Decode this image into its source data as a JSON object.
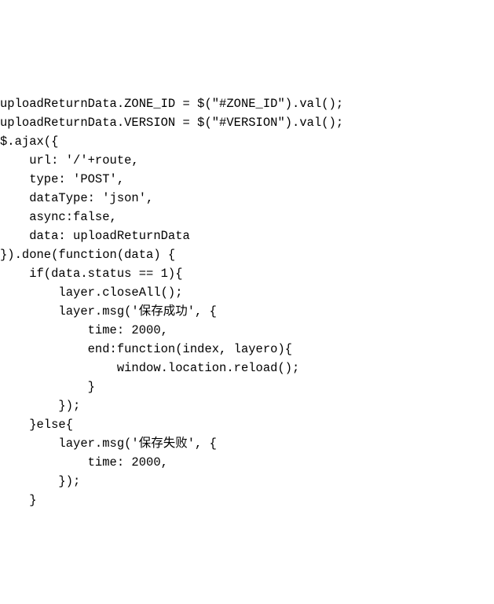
{
  "code": {
    "lines": [
      "uploadReturnData.ZONE_ID = $(\"#ZONE_ID\").val();",
      "uploadReturnData.VERSION = $(\"#VERSION\").val();",
      "$.ajax({",
      "    url: '/'+route,",
      "    type: 'POST',",
      "    dataType: 'json',",
      "    async:false,",
      "    data: uploadReturnData",
      "}).done(function(data) {",
      "    if(data.status == 1){",
      "        layer.closeAll();",
      "        layer.msg('保存成功', {",
      "            time: 2000,",
      "            end:function(index, layero){",
      "                window.location.reload();",
      "            }",
      "        });",
      "    }else{",
      "        layer.msg('保存失败', {",
      "            time: 2000,",
      "        });",
      "    }"
    ]
  }
}
